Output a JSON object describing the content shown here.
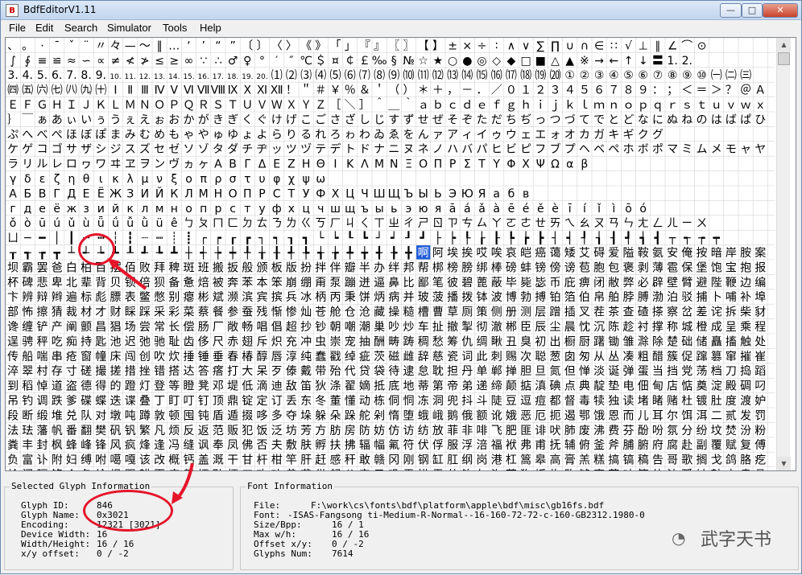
{
  "window": {
    "title": "BdfEditorV1.11",
    "minimize_glyph": "—",
    "maximize_glyph": "□",
    "close_glyph": "✕"
  },
  "menu": [
    "File",
    "Edit",
    "Search",
    "Simulator",
    "Tools",
    "Help"
  ],
  "grid": {
    "rows": [
      "、 。 · ˉ ˇ ¨ 〃 々 — ～ ‖ … ‘ ’ “ ” 〔 〕 〈 〉 《 》 「 」 『 』 〖 〗 【 】 ± × ÷ ∶ ∧ ∨ ∑ ∏ ∪ ∩ ∈ ∷ √ ⊥ ∥ ∠ ⌒ ⊙",
      "∫ ∮ ≡ ≌ ≈ ∽ ∝ ≠ ≮ ≯ ≤ ≥ ∞ ∵ ∴ ♂ ♀ ° ′ ″ ℃ ＄ ¤ ￠ ￡ ‰ § № ☆ ★ ○ ● ◎ ◇ ◆ □ ■ △ ▲ ※ → ← ↑ ↓ 〓 1. 2.",
      "3. 4. 5. 6. 7. 8. 9. 10. 11. 12. 13. 14. 15. 16. 17. 18. 19. 20. ⑴ ⑵ ⑶ ⑷ ⑸ ⑹ ⑺ ⑻ ⑼ ⑽ ⑾ ⑿ ⒀ ⒁ ⒂ ⒃ ⒄ ⒅ ⒆ ⒇ ① ② ③ ④ ⑤ ⑥ ⑦ ⑧ ⑨ ⑩ ㈠ ㈡ ㈢",
      "㈣ ㈤ ㈥ ㈦ ㈧ ㈨ ㈩ Ⅰ Ⅱ Ⅲ Ⅳ Ⅴ Ⅵ Ⅶ Ⅷ Ⅸ Ⅹ Ⅺ Ⅻ ！ ＂ ＃ ￥ ％ ＆ ＇ （ ） ＊ ＋ ， － ． ／ ０ １ ２ ３ ４ ５ ６ ７ ８ ９ ： ； ＜ ＝ ＞ ？ ＠ Ａ Ｂ Ｃ Ｄ",
      "Ｅ Ｆ Ｇ Ｈ Ｉ Ｊ Ｋ Ｌ Ｍ Ｎ Ｏ Ｐ Ｑ Ｒ Ｓ Ｔ Ｕ Ｖ Ｗ Ｘ Ｙ Ｚ ［ ＼ ］ ＾ ＿ ｀ ａ ｂ ｃ ｄ ｅ ｆ ｇ ｈ ｉ ｊ ｋ ｌ ｍ ｎ ｏ ｐ ｑ ｒ ｓ ｔ ｕ ｖ ｗ ｘ ｙ ｚ ｛ ｜",
      "｝ ￣ ぁ あ ぃ い ぅ う ぇ え ぉ お か が き ぎ く ぐ け げ こ ご さ ざ し じ す ず せ ぜ そ ぞ た だ ち ぢ っ つ づ て で と ど な に ぬ ね の は ば ぱ ひ び ぴ ふ ぶ",
      "ぷ へ べ ぺ ほ ぼ ぽ ま み む め も ゃ や ゅ ゆ ょ よ ら り る れ ろ ゎ わ ゐ ゑ を ん ァ ア ィ イ ゥ ウ ェ エ ォ オ カ ガ キ ギ ク グ",
      "ケ ゲ コ ゴ サ ザ シ ジ ス ズ セ ゼ ソ ゾ タ ダ チ ヂ ッ ツ ヅ テ デ ト ド ナ ニ ヌ ネ ノ ハ バ パ ヒ ビ ピ フ ブ プ ヘ ベ ペ ホ ボ ポ マ ミ ム メ モ ャ ヤ ュ ユ ョ ヨ",
      "ラ リ ル レ ロ ヮ ワ ヰ ヱ ヲ ン ヴ ヵ ヶ Α Β Γ Δ Ε Ζ Η Θ Ι Κ Λ Μ Ν Ξ Ο Π Ρ Σ Τ Υ Φ Χ Ψ Ω α β",
      "γ δ ε ζ η θ ι κ λ μ ν ξ ο π ρ σ τ υ φ χ ψ ω",
      "А Б В Г Д Е Ё Ж З И Й К Л М Н О П Р С Т У Ф Х Ц Ч Ш Щ Ъ Ы Ь Э Ю Я а б в",
      "г д е ё ж з и й к л м н о п р с т у ф х ц ч ш щ ъ ы ь э ю я ā á ǎ à ē é ě è ī í ǐ ì ō ó",
      "ǒ ò ū ú ǔ ù ǖ ǘ ǚ ǜ ü ê ㄅ ㄆ ㄇ ㄈ ㄉ ㄊ ㄋ ㄌ ㄍ ㄎ ㄏ ㄐ ㄑ ㄒ ㄓ ㄔ ㄕ ㄖ ㄗ ㄘ ㄙ ㄚ ㄛ ㄜ ㄝ ㄞ ㄟ ㄠ ㄡ ㄢ ㄣ ㄤ ㄥ ㄦ ㄧ ㄨ",
      "ㄩ ─ ━ │ ┃ ┄ ┅ ┆ ┇ ┈ ┉ ┊ ┋ ┌ ┍ ┎ ┏ ┐ ┑ ┒ ┓ └ ┕ ┖ ┗ ┘ ┙ ┚ ┛ ├ ┝ ┞ ┟ ┠ ┡ ┢ ┣ ┤ ┥ ┦ ┧ ┨ ┩ ┪ ┫ ┬ ┭ ┮ ┯",
      "┰ ┱ ┲ ┳ ┴ ┵ ┶ ┷ ┸ ┹ ┺ ┻ ┼ ┽ ┾ ┿ ╀ ╁ ╂ ╃ ╄ ╅ ╆ ╇ ╈ ╉ ╊ ╋ 啊 阿 埃 挨 哎 唉 哀 皑 癌 蔼 矮 艾 碍 爱 隘 鞍 氨 安 俺 按 暗 岸 胺 案 肮 昂 盎 凹 敖 熬 翱 袄 傲 奥 懊 澳 芭 捌 扒 叭 吧 笆 八 疤 巴 拔 跋 靶 把 耙",
      "坝 霸 罢 爸 白 柏 百 摆 佰 败 拜 稗 斑 班 搬 扳 般 颁 板 版 扮 拌 伴 瓣 半 办 绊 邦 帮 梆 榜 膀 绑 棒 磅 蚌 镑 傍 谤 苞 胞 包 褒 剥 薄 雹 保 堡 饱 宝 抱 报 暴 豹 鲍 爆",
      "杯 碑 悲 卑 北 辈 背 贝 钡 倍 狈 备 惫 焙 被 奔 苯 本 笨 崩 绷 甭 泵 蹦 迸 逼 鼻 比 鄙 笔 彼 碧 蓖 蔽 毕 毙 毖 币 庇 痹 闭 敝 弊 必 辟 壁 臂 避 陛 鞭 边 编 贬 扁 便 变",
      "卞 辨 辩 辫 遍 标 彪 膘 表 鳖 憋 别 瘪 彬 斌 濒 滨 宾 摈 兵 冰 柄 丙 秉 饼 炳 病 并 玻 菠 播 拨 钵 波 博 勃 搏 铂 箔 伯 帛 舶 脖 膊 渤 泊 驳 捕 卜 哺 补 埠 不 布 步 簿",
      "部 怖 擦 猜 裁 材 才 财 睬 踩 采 彩 菜 蔡 餐 参 蚕 残 惭 惨 灿 苍 舱 仓 沧 藏 操 糙 槽 曹 草 厕 策 侧 册 测 层 蹭 插 叉 茬 茶 查 碴 搽 察 岔 差 诧 拆 柴 豺 搀 掺 蝉 馋",
      "谗 缠 铲 产 阐 颤 昌 猖 场 尝 常 长 偿 肠 厂 敞 畅 唱 倡 超 抄 钞 朝 嘲 潮 巢 吵 炒 车 扯 撤 掣 彻 澈 郴 臣 辰 尘 晨 忱 沉 陈 趁 衬 撑 称 城 橙 成 呈 乘 程 惩 澄 诚 承",
      "逞 骋 秤 吃 痴 持 匙 池 迟 弛 驰 耻 齿 侈 尺 赤 翅 斥 炽 充 冲 虫 崇 宠 抽 酬 畴 踌 稠 愁 筹 仇 绸 瞅 丑 臭 初 出 橱 厨 躇 锄 雏 滁 除 楚 础 储 矗 搐 触 处 揣 川 穿 椽",
      "传 船 喘 串 疮 窗 幢 床 闯 创 吹 炊 捶 锤 垂 春 椿 醇 唇 淳 纯 蠢 戳 绰 疵 茨 磁 雌 辞 慈 瓷 词 此 刺 赐 次 聪 葱 囱 匆 从 丛 凑 粗 醋 簇 促 蹿 篡 窜 摧 崔 催 脆 瘁 粹",
      "淬 翠 村 存 寸 磋 撮 搓 措 挫 错 搭 达 答 瘩 打 大 呆 歹 傣 戴 带 殆 代 贷 袋 待 逮 怠 耽 担 丹 单 郸 掸 胆 旦 氮 但 惮 淡 诞 弹 蛋 当 挡 党 荡 档 刀 捣 蹈 倒 岛 祷 导",
      "到 稻 悼 道 盗 德 得 的 蹬 灯 登 等 瞪 凳 邓 堤 低 滴 迪 敌 笛 狄 涤 翟 嫡 抵 底 地 蒂 第 帝 弟 递 缔 颠 掂 滇 碘 点 典 靛 垫 电 佃 甸 店 惦 奠 淀 殿 碉 叼 雕 凋 刁 掉",
      "吊 钓 调 跌 爹 碟 蝶 迭 谍 叠 丁 盯 叮 钉 顶 鼎 锭 定 订 丢 东 冬 董 懂 动 栋 侗 恫 冻 洞 兜 抖 斗 陡 豆 逗 痘 都 督 毒 犊 独 读 堵 睹 赌 杜 镀 肚 度 渡 妒 端 短 锻",
      "段 断 缎 堆 兑 队 对 墩 吨 蹲 敦 顿 囤 钝 盾 遁 掇 哆 多 夺 垛 躲 朵 跺 舵 剁 惰 堕 蛾 峨 鹅 俄 额 讹 娥 恶 厄 扼 遏 鄂 饿 恩 而 儿 耳 尔 饵 洱 二 贰 发 罚 筏 伐 乏 阀",
      "法 珐 藩 帆 番 翻 樊 矾 钒 繁 凡 烦 反 返 范 贩 犯 饭 泛 坊 芳 方 肪 房 防 妨 仿 访 纺 放 菲 非 啡 飞 肥 匪 诽 吠 肺 废 沸 费 芬 酚 吩 氛 分 纷 坟 焚 汾 粉 奋 份 忿 愤",
      "粪 丰 封 枫 蜂 峰 锋 风 疯 烽 逢 冯 缝 讽 奉 凤 佛 否 夫 敷 肤 孵 扶 拂 辐 幅 氟 符 伏 俘 服 浮 涪 福 袱 弗 甫 抚 辅 俯 釜 斧 脯 腑 府 腐 赴 副 覆 赋 复 傅 付 阜 父 腹",
      "负 富 讣 附 妇 缚 咐 噶 嘎 该 改 概 钙 盖 溉 干 甘 杆 柑 竿 肝 赶 感 秆 敢 赣 冈 刚 钢 缸 肛 纲 岗 港 杠 篙 皋 高 膏 羔 糕 搞 镐 稿 告 哥 歌 搁 戈 鸽 胳 疙 割 革 葛 格",
      "蛤 阁 隔 铬 个 各 给 根 跟 耕 更 庚 羹 埂 耿 梗 工 攻 功 恭 龚 供 躬 公 宫 弓 巩 汞 拱 贡 共 钩 勾 沟 苟 狗 垢 构 购 够 辜 菇 咕 箍 估 沽 孤 姑 鼓 古 蛊 骨 谷 股 故 顾"
    ]
  },
  "selected": {
    "title": "Selected Glyph Information",
    "rows": [
      {
        "label": "Glyph ID:",
        "value": "846"
      },
      {
        "label": "Glyph Name:",
        "value": "0x3021"
      },
      {
        "label": "Encoding:",
        "value": "12321 [3021]"
      },
      {
        "label": "Device Width:",
        "value": "16"
      },
      {
        "label": "Width/Height:",
        "value": "16 / 16"
      },
      {
        "label": "x/y offset:",
        "value": "0 / -2"
      }
    ]
  },
  "font_info": {
    "title": "Font Information",
    "rows": [
      {
        "label": "File:",
        "value": "F:\\work\\cs\\fonts\\bdf\\platform\\apple\\bdf\\misc\\gb16fs.bdf"
      },
      {
        "label": "Font:",
        "value": "-ISAS-Fangsong ti-Medium-R-Normal--16-160-72-72-c-160-GB2312.1980-0"
      },
      {
        "label": "Size/Bpp:",
        "value": "16 / 1"
      },
      {
        "label": "Max w/h:",
        "value": "16 / 16"
      },
      {
        "label": "Offset x/y:",
        "value": "0 / -2"
      },
      {
        "label": "Glyphs Num:",
        "value": "7614"
      }
    ]
  },
  "watermark": {
    "text": "武字天书",
    "icon": "wechat-icon"
  },
  "colors": {
    "annotation": "#e5152a",
    "selection": "#1e5bd8"
  }
}
